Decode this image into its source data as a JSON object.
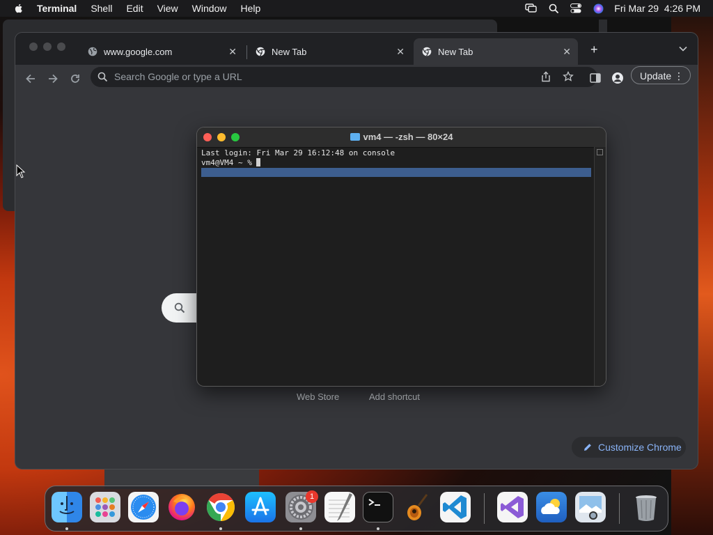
{
  "menubar": {
    "app_name": "Terminal",
    "items": [
      "Shell",
      "Edit",
      "View",
      "Window",
      "Help"
    ],
    "clock": "Fri Mar 29  4:26 PM"
  },
  "browser": {
    "tabs": [
      {
        "title": "www.google.com",
        "icon": "globe-icon",
        "active": false
      },
      {
        "title": "New Tab",
        "icon": "chrome-icon",
        "active": false
      },
      {
        "title": "New Tab",
        "icon": "chrome-icon",
        "active": true
      }
    ],
    "omnibox_placeholder": "Search Google or type a URL",
    "update_label": "Update",
    "links": [
      "Web Store",
      "Add shortcut"
    ],
    "customize_label": "Customize Chrome",
    "accent": "#8ab4f8"
  },
  "terminal": {
    "title": "vm4 — -zsh — 80×24",
    "lines": [
      "Last login: Fri Mar 29 16:12:48 on console",
      "vm4@VM4 ~ % "
    ],
    "selection_color": "#3d5e8f"
  },
  "dock": {
    "items": [
      {
        "name": "finder-icon",
        "running": true
      },
      {
        "name": "launchpad-icon",
        "running": false
      },
      {
        "name": "safari-icon",
        "running": false
      },
      {
        "name": "firefox-icon",
        "running": false
      },
      {
        "name": "chrome-icon",
        "running": true
      },
      {
        "name": "app-store-icon",
        "running": false
      },
      {
        "name": "system-settings-icon",
        "running": true
      },
      {
        "name": "textedit-icon",
        "running": false
      },
      {
        "name": "terminal-icon",
        "running": true
      },
      {
        "name": "garageband-icon",
        "running": false
      },
      {
        "name": "vscode-icon",
        "running": false
      },
      {
        "name": "visual-studio-icon",
        "running": false
      },
      {
        "name": "weather-icon",
        "running": false
      },
      {
        "name": "preview-icon",
        "running": false
      },
      {
        "name": "trash-icon",
        "running": false
      }
    ],
    "settings_badge": "1"
  }
}
